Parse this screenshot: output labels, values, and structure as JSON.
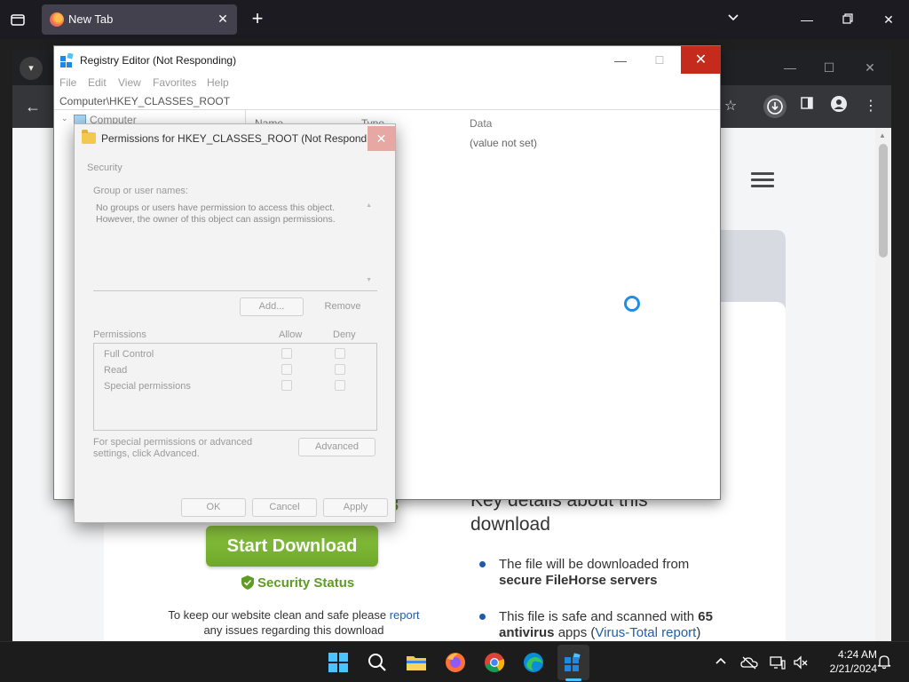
{
  "firefox": {
    "tab_title": "New Tab"
  },
  "webpage": {
    "partial_number": "3",
    "start_download": "Start Download",
    "security_status": "Security Status",
    "keep_text_1": "To keep our website clean and safe please ",
    "keep_link": "report",
    "keep_text_2": "any issues regarding this download",
    "key_details": "Key details about this download",
    "bullet1_a": "The file will be downloaded from ",
    "bullet1_b": "secure FileHorse servers",
    "bullet2_a": "This file is safe and scanned with ",
    "bullet2_b": "65 antivirus",
    "bullet2_c": " apps (",
    "bullet2_link": "Virus-Total report",
    "bullet2_d": ")"
  },
  "regedit": {
    "title": "Registry Editor (Not Responding)",
    "menu": [
      "File",
      "Edit",
      "View",
      "Favorites",
      "Help"
    ],
    "address": "Computer\\HKEY_CLASSES_ROOT",
    "tree_root": "Computer",
    "columns": {
      "name": "Name",
      "type": "Type",
      "data": "Data"
    },
    "value_data": "(value not set)"
  },
  "permissions": {
    "title": "Permissions for HKEY_CLASSES_ROOT (Not Responding)",
    "security_tab": "Security",
    "group_label": "Group or user names:",
    "group_message": "No groups or users have permission to access this object. However, the owner of this object can assign permissions.",
    "add_button": "Add...",
    "remove_button": "Remove",
    "permissions_label": "Permissions",
    "allow_label": "Allow",
    "deny_label": "Deny",
    "rows": [
      "Full Control",
      "Read",
      "Special permissions"
    ],
    "advanced_note": "For special permissions or advanced settings, click Advanced.",
    "advanced_button": "Advanced",
    "ok_button": "OK",
    "cancel_button": "Cancel",
    "apply_button": "Apply"
  },
  "taskbar": {
    "time": "4:24 AM",
    "date": "2/21/2024"
  },
  "colors": {
    "accent_green": "#8cc63f",
    "close_red": "#c42b1c",
    "link_blue": "#1f5fa8"
  }
}
